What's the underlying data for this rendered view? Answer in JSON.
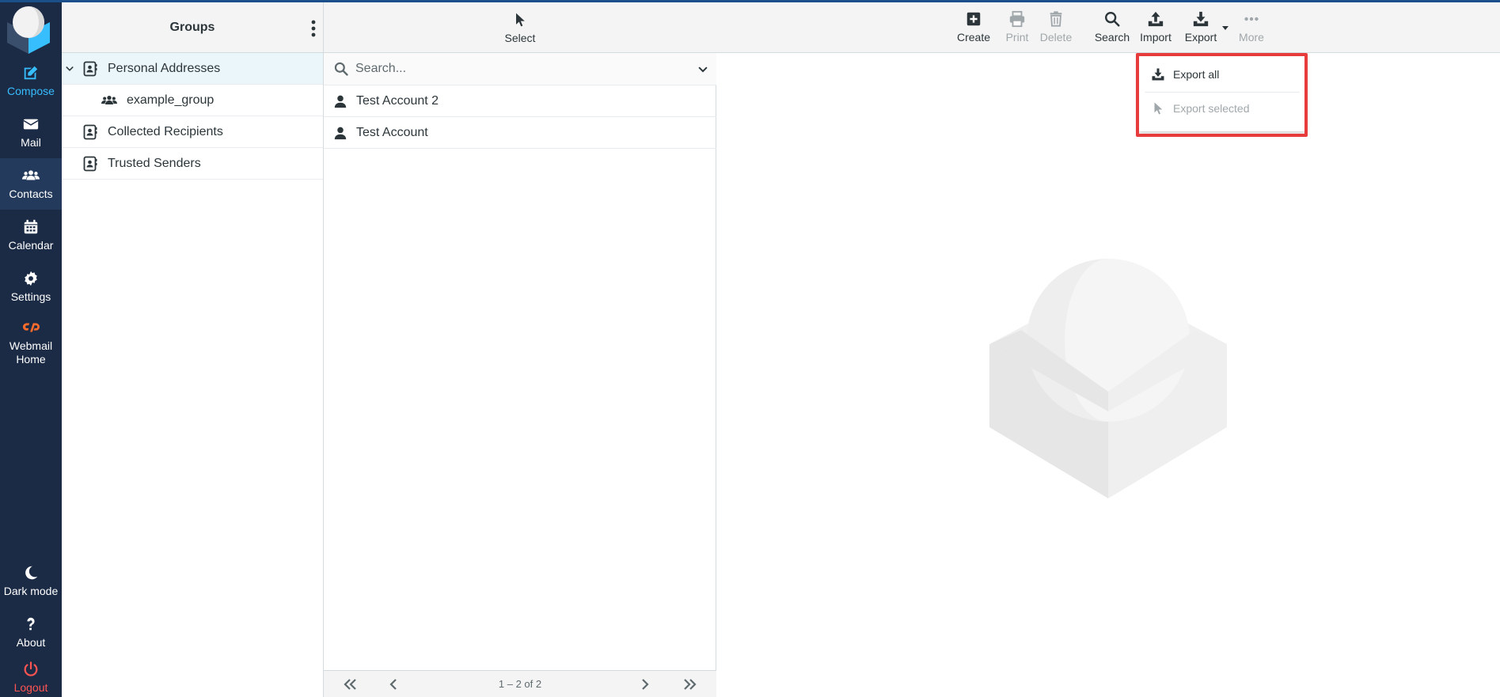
{
  "nav": {
    "items": [
      {
        "label": "Compose",
        "icon": "compose-icon"
      },
      {
        "label": "Mail",
        "icon": "envelope-icon"
      },
      {
        "label": "Contacts",
        "icon": "users-icon"
      },
      {
        "label": "Calendar",
        "icon": "calendar-icon"
      },
      {
        "label": "Settings",
        "icon": "gear-icon"
      },
      {
        "label": "Webmail Home",
        "icon": "cpanel-icon"
      }
    ],
    "bottom": [
      {
        "label": "Dark mode",
        "icon": "moon-icon"
      },
      {
        "label": "About",
        "icon": "question-icon"
      },
      {
        "label": "Logout",
        "icon": "power-icon"
      }
    ],
    "active": "Contacts"
  },
  "groups": {
    "title": "Groups",
    "items": [
      {
        "label": "Personal Addresses"
      },
      {
        "label": "example_group"
      },
      {
        "label": "Collected Recipients"
      },
      {
        "label": "Trusted Senders"
      }
    ]
  },
  "list": {
    "select_label": "Select",
    "search_placeholder": "Search...",
    "contacts": [
      {
        "name": "Test Account 2"
      },
      {
        "name": "Test Account"
      }
    ],
    "pager_text": "1 – 2 of 2"
  },
  "toolbar": {
    "create": "Create",
    "print": "Print",
    "delete": "Delete",
    "search": "Search",
    "import": "Import",
    "export": "Export",
    "more": "More"
  },
  "export_menu": {
    "export_all": "Export all",
    "export_selected": "Export selected"
  },
  "colors": {
    "nav_bg": "#1b2a45",
    "accent": "#37beff",
    "logout": "#ff5552",
    "highlight": "#e83c3c"
  }
}
